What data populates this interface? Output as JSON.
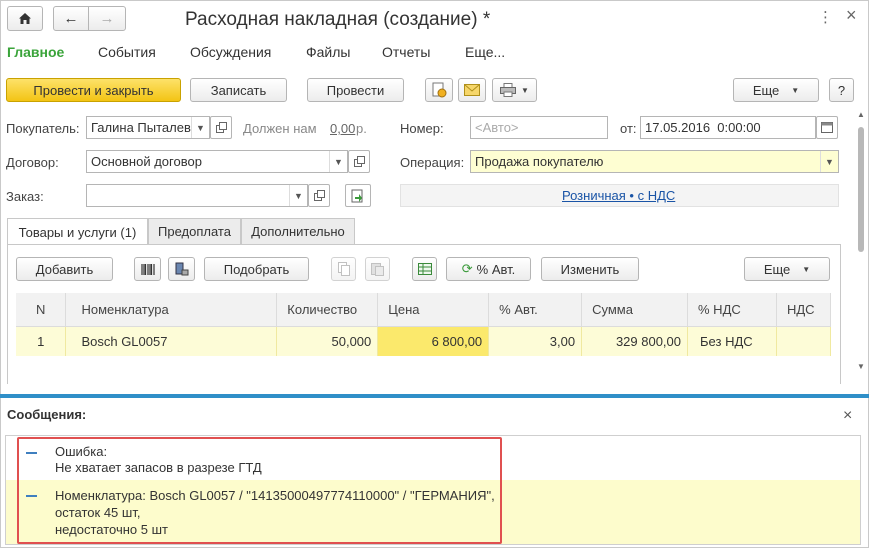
{
  "window": {
    "title": "Расходная накладная (создание) *",
    "close_glyph": "×"
  },
  "nav": {
    "home_icon": "home-icon",
    "back_glyph": "←",
    "forward_glyph": "→",
    "more_glyph": "⋮"
  },
  "menu": {
    "items": [
      "Главное",
      "События",
      "Обсуждения",
      "Файлы",
      "Отчеты",
      "Еще..."
    ]
  },
  "toolbar": {
    "post_close": "Провести и закрыть",
    "save": "Записать",
    "post": "Провести",
    "more": "Еще",
    "help": "?"
  },
  "form": {
    "buyer_label": "Покупатель:",
    "buyer_value": "Галина Пыталев",
    "debt_label": "Должен нам",
    "debt_value": "0,00",
    "debt_unit": "р.",
    "number_label": "Номер:",
    "number_placeholder": "<Авто>",
    "date_label": "от:",
    "date_value": "17.05.2016  0:00:00",
    "contract_label": "Договор:",
    "contract_value": "Основной договор",
    "operation_label": "Операция:",
    "operation_value": "Продажа покупателю",
    "order_label": "Заказ:",
    "order_value": "",
    "price_link": "Розничная • с НДС"
  },
  "tabs": [
    "Товары и услуги (1)",
    "Предоплата",
    "Дополнительно"
  ],
  "table_toolbar": {
    "add": "Добавить",
    "pick": "Подобрать",
    "auto_pct": "% Авт.",
    "change": "Изменить",
    "more": "Еще"
  },
  "table": {
    "columns": [
      "N",
      "Номенклатура",
      "Количество",
      "Цена",
      "% Авт.",
      "Сумма",
      "% НДС",
      "НДС"
    ],
    "rows": [
      [
        "1",
        "Bosch GL0057",
        "50,000",
        "6 800,00",
        "3,00",
        "329 800,00",
        "Без НДС",
        ""
      ]
    ]
  },
  "messages": {
    "title": "Сообщения:",
    "close_glyph": "×",
    "items": [
      {
        "line1": "Ошибка:",
        "line2": "Не хватает запасов в разрезе ГТД"
      },
      {
        "line1": "Номенклатура: Bosch GL0057 / \"14135000497774110000\" / \"ГЕРМАНИЯ\",",
        "line2": "остаток 45 шт,",
        "line3": "недостаточно 5 шт"
      }
    ]
  },
  "colors": {
    "accent_green": "#3aa43a",
    "primary_button": "#f3c414",
    "highlight_yellow": "#fdfcd7",
    "error_border": "#e05050",
    "divider_blue": "#2f8fc8"
  }
}
